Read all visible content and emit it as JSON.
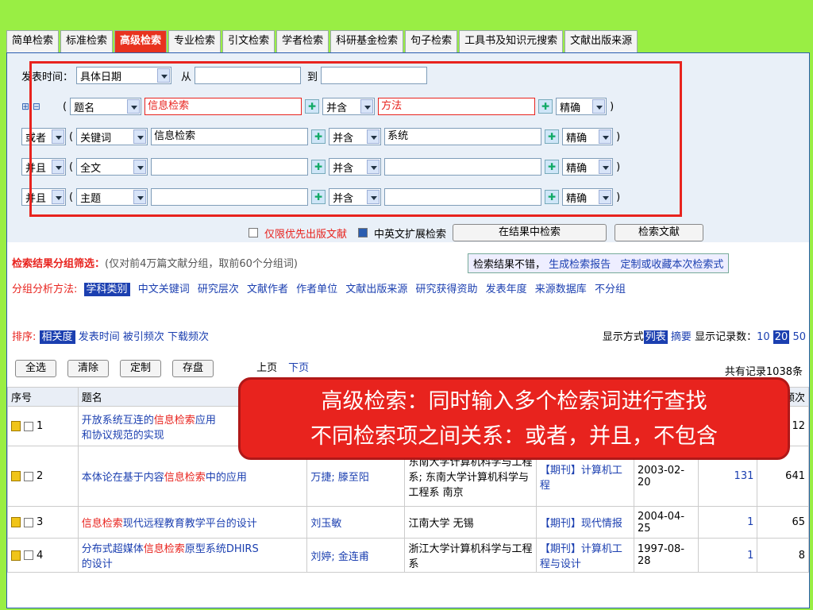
{
  "tabs": [
    "简单检索",
    "标准检索",
    "高级检索",
    "专业检索",
    "引文检索",
    "学者检索",
    "科研基金检索",
    "句子检索",
    "工具书及知识元搜索",
    "文献出版来源"
  ],
  "date": {
    "label": "发表时间：",
    "type": "具体日期",
    "from": "从",
    "to": "到"
  },
  "rows": [
    {
      "logic": "",
      "field": "题名",
      "value1": "信息检索",
      "rel": "并含",
      "value2": "方法",
      "match": "精确"
    },
    {
      "logic": "或者",
      "field": "关键词",
      "value1": "信息检索",
      "rel": "并含",
      "value2": "系统",
      "match": "精确"
    },
    {
      "logic": "并且",
      "field": "全文",
      "value1": "",
      "rel": "并含",
      "value2": "",
      "match": "精确"
    },
    {
      "logic": "并且",
      "field": "主题",
      "value1": "",
      "rel": "并含",
      "value2": "",
      "match": "精确"
    }
  ],
  "options": {
    "priority": "仅限优先出版文献",
    "expand": "中英文扩展检索",
    "in_result": "在结果中检索",
    "search": "检索文献"
  },
  "group": {
    "title": "检索结果分组筛选：",
    "note": "(仅对前4万篇文献分组，取前60个分组词)",
    "report": "检索结果不错，",
    "gen": "生成检索报告",
    "custom": "定制或收藏本次检索式",
    "method": "分组分析方法:",
    "items": [
      "学科类别",
      "中文关键词",
      "研究层次",
      "文献作者",
      "作者单位",
      "文献出版来源",
      "研究获得资助",
      "发表年度",
      "来源数据库",
      "不分组"
    ]
  },
  "sort": {
    "label": "排序:",
    "items": [
      "相关度",
      "发表时间",
      "被引频次",
      "下载频次"
    ],
    "display": "显示方式",
    "list": "列表",
    "abstract": "摘要",
    "count_label": "显示记录数：",
    "counts": [
      "10",
      "20",
      "50"
    ]
  },
  "actions": {
    "all": "全选",
    "clear": "清除",
    "custom": "定制",
    "save": "存盘",
    "prev": "上页",
    "next": "下页",
    "total": "共有记录1038条"
  },
  "headers": {
    "no": "序号",
    "title": "题名",
    "dl": "频次"
  },
  "callout": {
    "line1": "高级检索：同时输入多个检索词进行查找",
    "line2": "不同检索项之间关系：或者，并且，不包含"
  },
  "results": [
    {
      "no": "1",
      "t1": "开放系统互连的",
      "hl": "信息检索",
      "t2": "应用",
      "t3": "和协议规范的实现",
      "author": "",
      "org": "",
      "src": "",
      "date": "",
      "cite": "",
      "dl": "12"
    },
    {
      "no": "2",
      "t1": "本体论在基于内容",
      "hl": "信息检索",
      "t2": "中的应用",
      "t3": "",
      "author": "万捷; 滕至阳",
      "org": "东南大学计算机科学与工程系; 东南大学计算机科学与工程系 南京",
      "src": "【期刊】计算机工程",
      "date": "2003-02-20",
      "cite": "131",
      "dl": "641"
    },
    {
      "no": "3",
      "t1": "",
      "hl": "信息检索",
      "t2": "现代远程教育教学平台的设计",
      "t3": "",
      "author": "刘玉敏",
      "org": "江南大学 无锡",
      "src": "【期刊】现代情报",
      "date": "2004-04-25",
      "cite": "1",
      "dl": "65"
    },
    {
      "no": "4",
      "t1": "分布式超媒体",
      "hl": "信息检索",
      "t2": "原型系统DHIRS",
      "t3": "的设计",
      "author": "刘婷; 金连甫",
      "org": "浙江大学计算机科学与工程系",
      "src": "【期刊】计算机工程与设计",
      "date": "1997-08-28",
      "cite": "1",
      "dl": "8"
    }
  ]
}
